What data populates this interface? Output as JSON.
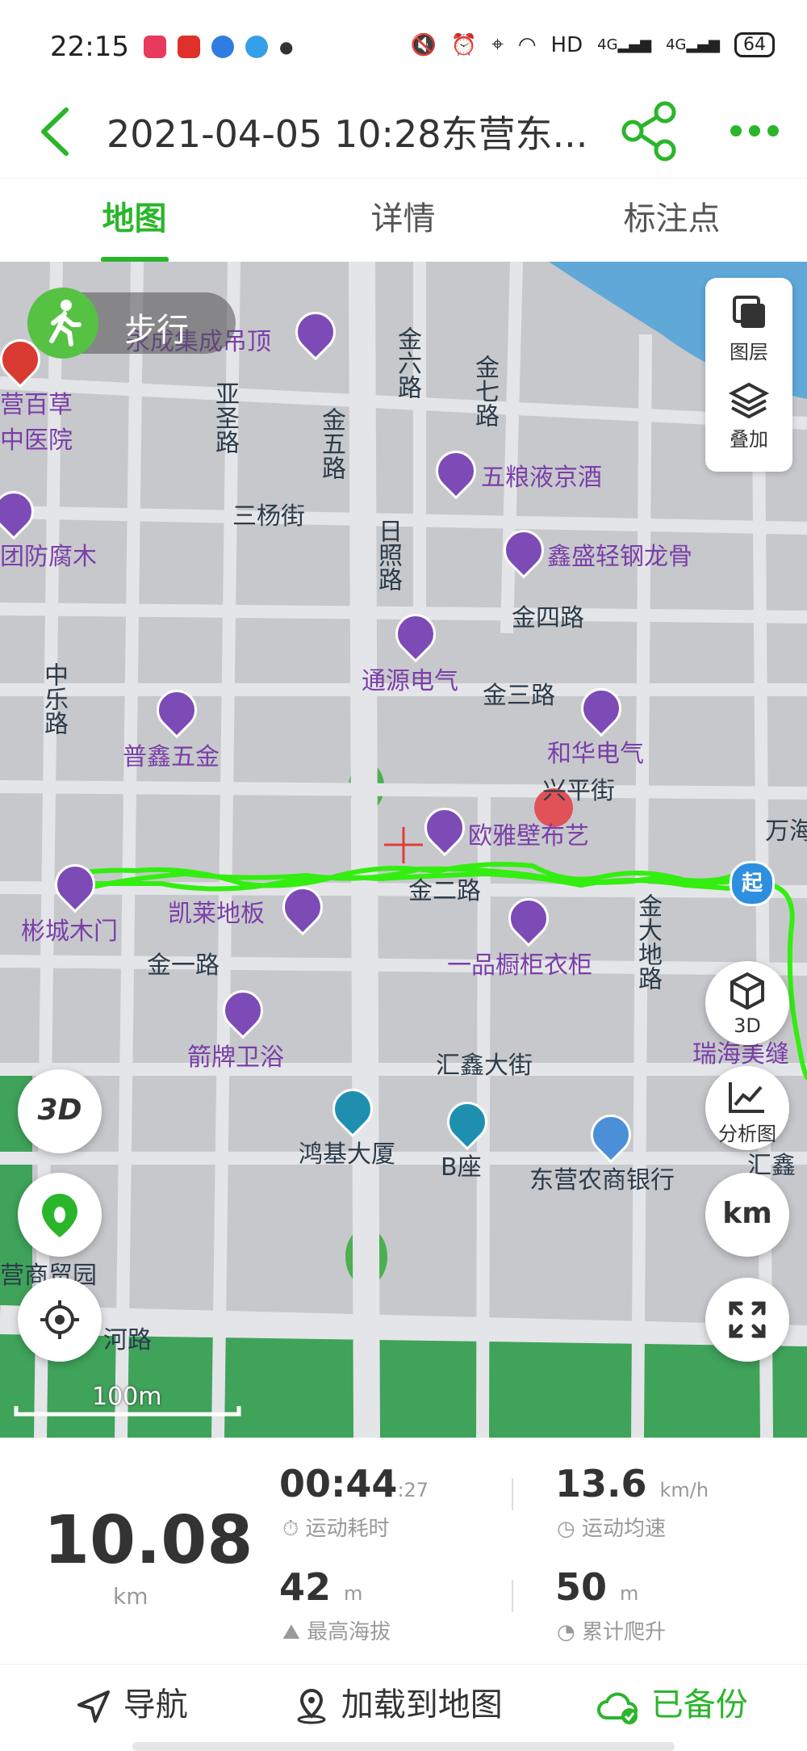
{
  "status_bar": {
    "time": "22:15",
    "network": "HD",
    "signal_1": "4G",
    "signal_2": "4G",
    "battery": "64"
  },
  "header": {
    "title": "2021-04-05 10:28东营东..."
  },
  "tabs": [
    {
      "label": "地图",
      "active": true
    },
    {
      "label": "详情",
      "active": false
    },
    {
      "label": "标注点",
      "active": false
    }
  ],
  "map": {
    "mode_label": "步行",
    "layers_label": "图层",
    "overlay_label": "叠加",
    "btn_3d_label": "3D",
    "analysis_label": "分析图",
    "km_label": "km",
    "scale_label": "100m",
    "start_label": "起",
    "street_labels": {
      "jinliu": "金六路",
      "jinqi": "金七路",
      "yasheng": "亚圣路",
      "jinwu": "金五路",
      "sanyang": "三杨街",
      "rizhao": "日照路",
      "jinsi": "金四路",
      "zhongle": "中乐路",
      "jinsan": "金三路",
      "xingping": "兴平街",
      "jiner": "金二路",
      "jinda": "金大地路",
      "jinyi": "金一路",
      "huixin": "汇鑫大街",
      "he": "河路",
      "wanhai": "万海"
    },
    "poi_labels": {
      "jicheng": "永成集成吊顶",
      "baicao": "营百草中医院",
      "wuliangye": "五粮液京酒",
      "fangfu": "团防腐木",
      "xinsheng": "鑫盛轻钢龙骨",
      "tongyuan": "通源电气",
      "puxin": "普鑫五金",
      "hehua": "和华电气",
      "ouya": "欧雅壁布艺",
      "bincheng": "彬城木门",
      "kailai": "凯莱地板",
      "yipin": "一品橱柜衣柜",
      "jianpai": "箭牌卫浴",
      "ruihai": "瑞海美缝",
      "hongji": "鸿基大厦",
      "bzuo": "B座",
      "nongshang": "东营农商银行",
      "huixin2": "汇鑫",
      "shangmao": "营商贸园"
    }
  },
  "stats": {
    "distance_value": "10.08",
    "distance_unit": "km",
    "duration_value": "00:44",
    "duration_seconds": ":27",
    "duration_label": "运动耗时",
    "speed_value": "13.6",
    "speed_unit": "km/h",
    "speed_label": "运动均速",
    "altitude_value": "42",
    "altitude_unit": "m",
    "altitude_label": "最高海拔",
    "climb_value": "50",
    "climb_unit": "m",
    "climb_label": "累计爬升"
  },
  "bottom_bar": {
    "navigate": "导航",
    "load_to_map": "加载到地图",
    "backed_up": "已备份"
  },
  "colors": {
    "accent": "#2bb52b",
    "track": "#33ee10",
    "poi": "#7c4bb5"
  }
}
